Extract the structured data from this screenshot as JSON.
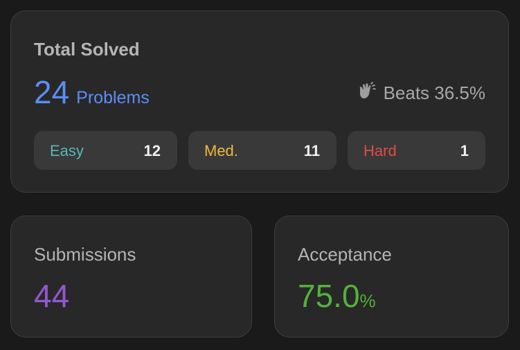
{
  "total": {
    "title": "Total Solved",
    "count": "24",
    "unit": "Problems",
    "beats": "Beats 36.5%",
    "icon": "clap-hands-icon"
  },
  "difficulty": [
    {
      "label": "Easy",
      "value": "12",
      "color": "#5ab7b5"
    },
    {
      "label": "Med.",
      "value": "11",
      "color": "#f0b93a"
    },
    {
      "label": "Hard",
      "value": "1",
      "color": "#e24b47"
    }
  ],
  "submissions": {
    "title": "Submissions",
    "value": "44",
    "color": "#9457cf"
  },
  "acceptance": {
    "title": "Acceptance",
    "value": "75.0",
    "suffix": "%",
    "color": "#54b13b"
  },
  "colors": {
    "accent": "#5c8df6",
    "card": "#282828",
    "background": "#1a1a1a"
  }
}
